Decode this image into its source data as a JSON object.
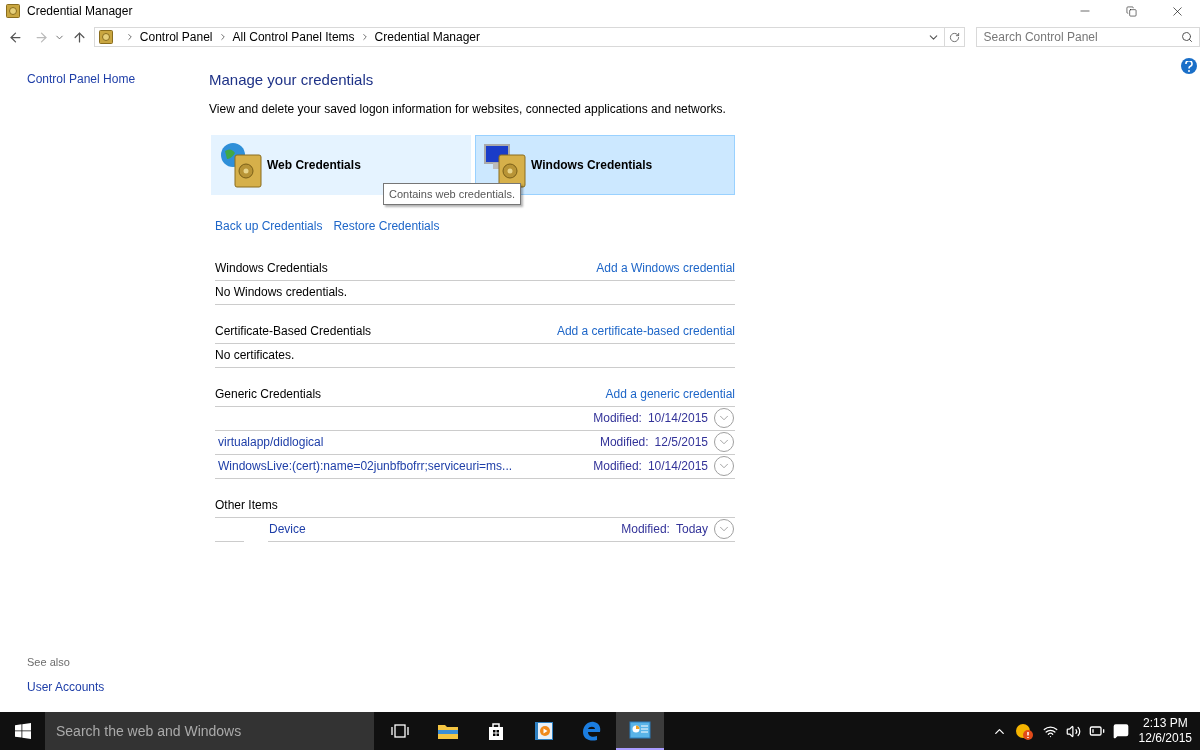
{
  "window": {
    "title": "Credential Manager"
  },
  "address_bar": {
    "breadcrumbs": [
      "Control Panel",
      "All Control Panel Items",
      "Credential Manager"
    ]
  },
  "search": {
    "placeholder": "Search Control Panel"
  },
  "sidebar": {
    "home_link": "Control Panel Home",
    "see_also": "See also",
    "links": [
      "User Accounts"
    ]
  },
  "main": {
    "heading": "Manage your credentials",
    "description": "View and delete your saved logon information for websites, connected applications and networks.",
    "tiles": [
      {
        "kind": "web",
        "label": "Web Credentials",
        "selected": false
      },
      {
        "kind": "windows",
        "label": "Windows Credentials",
        "selected": true
      }
    ],
    "tooltip": "Contains web credentials.",
    "actions": [
      "Back up Credentials",
      "Restore Credentials"
    ],
    "sections": [
      {
        "title": "Windows Credentials",
        "add_link": "Add a Windows credential",
        "empty_message": "No Windows credentials."
      },
      {
        "title": "Certificate-Based Credentials",
        "add_link": "Add a certificate-based credential",
        "empty_message": "No certificates."
      },
      {
        "title": "Generic Credentials",
        "add_link": "Add a generic credential",
        "items": [
          {
            "kind": "credential",
            "modified_label": "Modified:",
            "modified": "10/14/2015"
          },
          {
            "kind": "credential",
            "name": "virtualapp/didlogical",
            "modified_label": "Modified:",
            "modified": "12/5/2015"
          },
          {
            "kind": "credential",
            "name": "WindowsLive:(cert):name=02junbfbofrr;serviceuri=ms...",
            "modified_label": "Modified:",
            "modified": "10/14/2015"
          }
        ]
      },
      {
        "title": "Other Items",
        "items": [
          {
            "kind": "device",
            "name": "Device",
            "modified_label": "Modified:",
            "modified": "Today"
          }
        ]
      }
    ]
  },
  "taskbar": {
    "search_placeholder": "Search the web and Windows",
    "apps": [
      {
        "kind": "taskview",
        "selected": false
      },
      {
        "kind": "explorer",
        "selected": false
      },
      {
        "kind": "store",
        "selected": false
      },
      {
        "kind": "media",
        "selected": false
      },
      {
        "kind": "edge",
        "selected": false
      },
      {
        "kind": "controlpanel",
        "selected": true
      }
    ],
    "time": "2:13 PM",
    "date": "12/6/2015"
  }
}
